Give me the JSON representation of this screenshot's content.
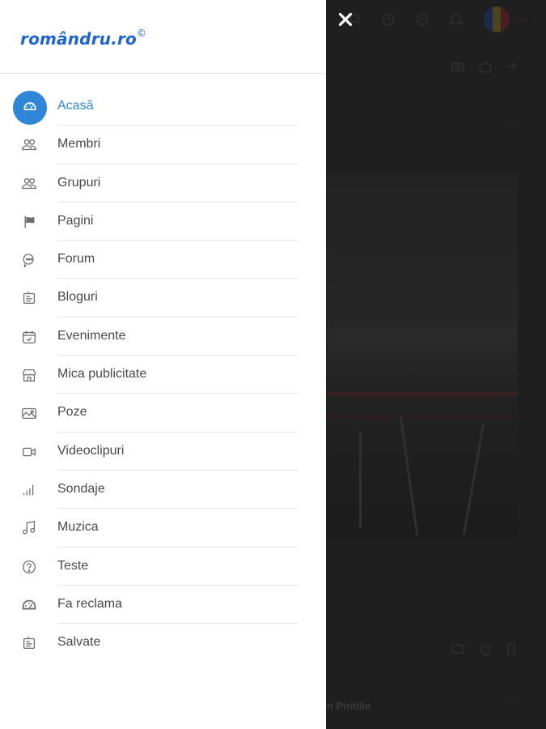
{
  "brand": {
    "logo_text": "romândru.ro",
    "logo_mark": "©",
    "accent_color": "#2f86d6",
    "logo_color": "#1e63d6"
  },
  "drawer": {
    "close_icon": "close-icon",
    "items": [
      {
        "label": "Acasă",
        "icon": "dashboard-icon",
        "active": true
      },
      {
        "label": "Membri",
        "icon": "members-icon",
        "active": false
      },
      {
        "label": "Grupuri",
        "icon": "groups-icon",
        "active": false
      },
      {
        "label": "Pagini",
        "icon": "flag-icon",
        "active": false
      },
      {
        "label": "Forum",
        "icon": "forum-icon",
        "active": false
      },
      {
        "label": "Bloguri",
        "icon": "blog-icon",
        "active": false
      },
      {
        "label": "Evenimente",
        "icon": "calendar-icon",
        "active": false
      },
      {
        "label": "Mica publicitate",
        "icon": "store-icon",
        "active": false
      },
      {
        "label": "Poze",
        "icon": "photos-icon",
        "active": false
      },
      {
        "label": "Videoclipuri",
        "icon": "video-icon",
        "active": false
      },
      {
        "label": "Sondaje",
        "icon": "poll-icon",
        "active": false
      },
      {
        "label": "Muzica",
        "icon": "music-icon",
        "active": false
      },
      {
        "label": "Teste",
        "icon": "question-icon",
        "active": false
      },
      {
        "label": "Fa reclama",
        "icon": "ads-icon",
        "active": false
      },
      {
        "label": "Salvate",
        "icon": "saved-icon",
        "active": false
      }
    ]
  },
  "background": {
    "author_name": "n Pintilie",
    "more_label": "···"
  }
}
